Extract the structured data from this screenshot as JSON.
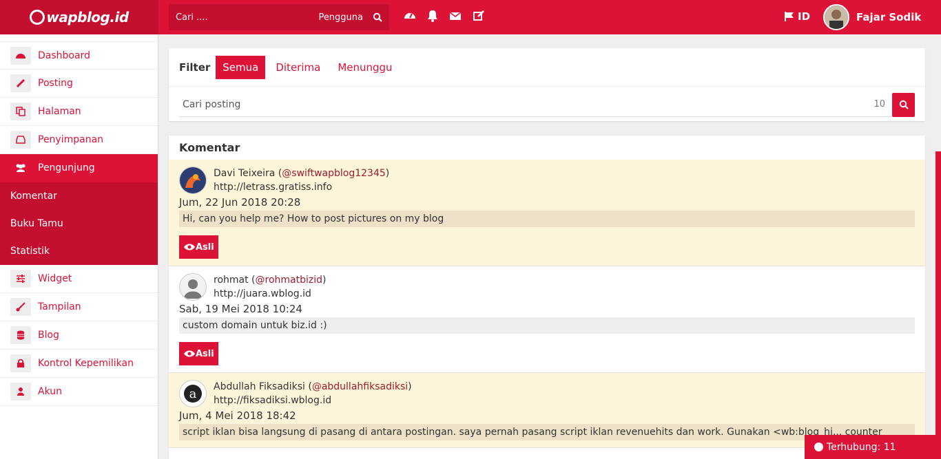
{
  "brand": {
    "name": "wapblog.id"
  },
  "header": {
    "search_placeholder": "Cari ....",
    "search_scope": "Pengguna",
    "icons": [
      "dashboard-icon",
      "bell-icon",
      "envelope-icon",
      "edit-icon"
    ],
    "language": "ID",
    "user_name": "Fajar Sodik"
  },
  "sidebar": {
    "items": [
      {
        "label": "Dashboard",
        "icon": "dashboard-icon"
      },
      {
        "label": "Posting",
        "icon": "pencil-icon"
      },
      {
        "label": "Halaman",
        "icon": "copy-icon"
      },
      {
        "label": "Penyimpanan",
        "icon": "inbox-icon"
      },
      {
        "label": "Pengunjung",
        "icon": "users-icon",
        "active": true
      },
      {
        "label": "Widget",
        "icon": "sliders-icon"
      },
      {
        "label": "Tampilan",
        "icon": "brush-icon"
      },
      {
        "label": "Blog",
        "icon": "database-icon"
      },
      {
        "label": "Kontrol Kepemilikan",
        "icon": "lock-icon"
      },
      {
        "label": "Akun",
        "icon": "user-icon"
      }
    ],
    "subitems": [
      {
        "label": "Komentar"
      },
      {
        "label": "Buku Tamu"
      },
      {
        "label": "Statistik"
      }
    ]
  },
  "filter": {
    "label": "Filter",
    "tabs": [
      {
        "label": "Semua",
        "active": true
      },
      {
        "label": "Diterima"
      },
      {
        "label": "Menunggu"
      }
    ],
    "search_placeholder": "Cari posting",
    "per_page": "10"
  },
  "comments": {
    "title": "Komentar",
    "button_label": "Asli",
    "items": [
      {
        "name": "Davi Teixeira",
        "handle": "@swiftwapblog12345",
        "url": "http://letrass.gratiss.info",
        "date": "Jum, 22 Jun 2018 20:28",
        "text": "Hi, can you help me? How to post pictures on my blog"
      },
      {
        "name": "rohmat",
        "handle": "@rohmatbizid",
        "url": "http://juara.wblog.id",
        "date": "Sab, 19 Mei 2018 10:24",
        "text": "custom domain untuk biz.id :)"
      },
      {
        "name": "Abdullah Fiksadiksi",
        "handle": "@abdullahfiksadiksi",
        "url": "http://fiksadiksi.wblog.id",
        "date": "Jum, 4 Mei 2018 18:42",
        "text": "script iklan bisa langsung di pasang di antara postingan. saya pernah pasang script iklan revenuehits dan work. Gunakan <wb:blog_hi... counter"
      }
    ]
  },
  "status": {
    "label": "Terhubung: 11"
  },
  "colors": {
    "primary": "#dd1237",
    "primary_dark": "#c40e2f",
    "highlight": "#fdf5da"
  }
}
